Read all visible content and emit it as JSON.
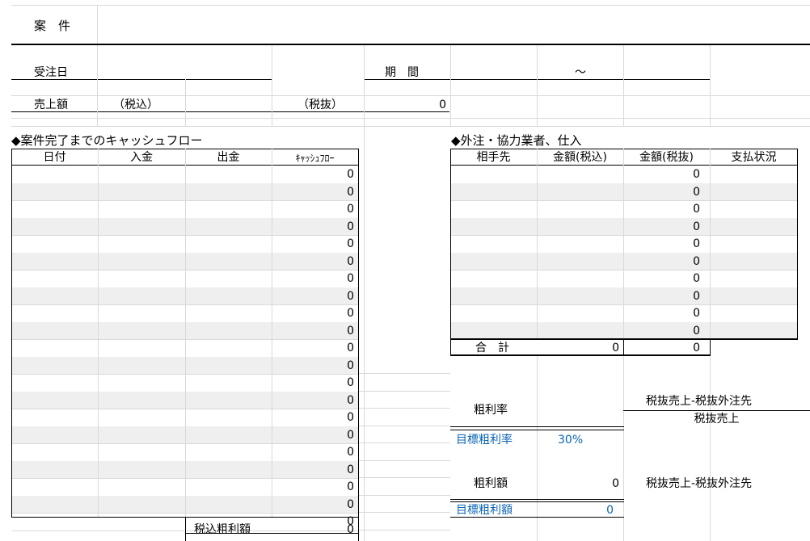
{
  "header": {
    "case_label": "案　件"
  },
  "info": {
    "order_date_label": "受注日",
    "period_label": "期　間",
    "period_sep": "～",
    "sales_label": "売上額",
    "tax_incl_label": "（税込）",
    "tax_excl_label": "（税抜）",
    "sales_excl_value": "0"
  },
  "cashflow": {
    "title": "◆案件完了までのキャッシュフロー",
    "columns": [
      "日付",
      "入金",
      "出金",
      "ｷｬｯｼｭﾌﾛｰ"
    ],
    "values": [
      "0",
      "0",
      "0",
      "0",
      "0",
      "0",
      "0",
      "0",
      "0",
      "0",
      "0",
      "0",
      "0",
      "0",
      "0",
      "0",
      "0",
      "0",
      "0",
      "0",
      "0"
    ],
    "gross_profit_label": "税込粗利額",
    "gross_profit_value": "0"
  },
  "outsource": {
    "title": "◆外注・協力業者、仕入",
    "columns": [
      "相手先",
      "金額(税込)",
      "金額(税抜)",
      "支払状況"
    ],
    "values": [
      "0",
      "0",
      "0",
      "0",
      "0",
      "0",
      "0",
      "0",
      "0",
      "0"
    ],
    "total_label": "合　計",
    "total_incl": "0",
    "total_excl": "0"
  },
  "summary": {
    "gross_rate_label": "粗利率",
    "formula_numerator": "税抜売上-税抜外注先",
    "formula_denominator": "税抜売上",
    "target_rate_label": "目標粗利率",
    "target_rate_value": "30%",
    "gross_amount_label": "粗利額",
    "gross_amount_value": "0",
    "gross_amount_formula": "税抜売上-税抜外注先",
    "target_amount_label": "目標粗利額",
    "target_amount_value": "0"
  }
}
